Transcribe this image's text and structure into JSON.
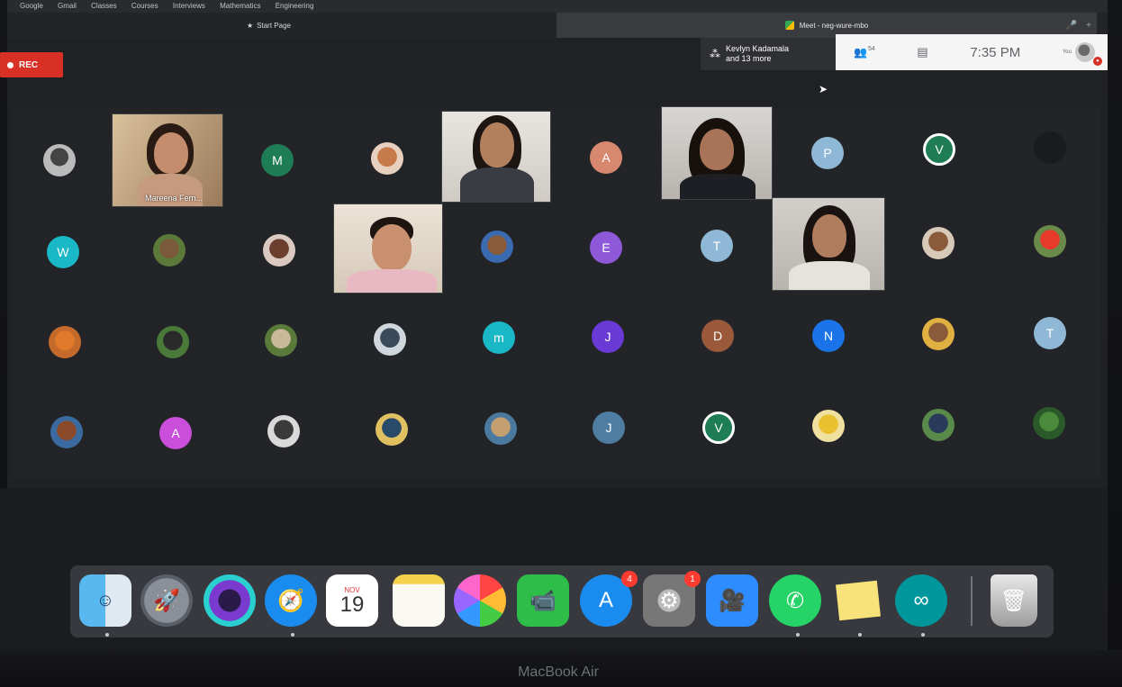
{
  "browser": {
    "bookmarks": [
      "Google",
      "Gmail",
      "Classes",
      "Courses",
      "Interviews",
      "Mathematics",
      "Engineering"
    ],
    "tab_start": "Start Page",
    "tab_meet": "Meet - neg-wure-mbo"
  },
  "meet": {
    "rec_label": "REC",
    "presenter_name": "Kevlyn Kadamala",
    "presenter_more": "and 13 more",
    "people_count": "54",
    "time": "7:35 PM",
    "you_label": "You",
    "video_name_1": "Mareena Fern..."
  },
  "avatars": {
    "row1": [
      "M",
      "A",
      "P",
      "V"
    ],
    "row2": [
      "W",
      "E",
      "T"
    ],
    "row3": [
      "m",
      "J",
      "D",
      "N",
      "T"
    ],
    "row4": [
      "A",
      "J",
      "V"
    ]
  },
  "colors": {
    "green": "#1e7d55",
    "salmon": "#d98870",
    "lightblue": "#8fb7d6",
    "teal": "#1ab7c6",
    "purple": "#8e59d9",
    "brown": "#9a5a3a",
    "blue": "#1a73e8",
    "magenta": "#c94ed9",
    "slate": "#4f7da1",
    "violet": "#6a3ad6"
  },
  "dock": {
    "calendar_month": "NOV",
    "calendar_day": "19",
    "appstore_badge": "4",
    "settings_badge": "1"
  },
  "laptop_label": "MacBook Air"
}
